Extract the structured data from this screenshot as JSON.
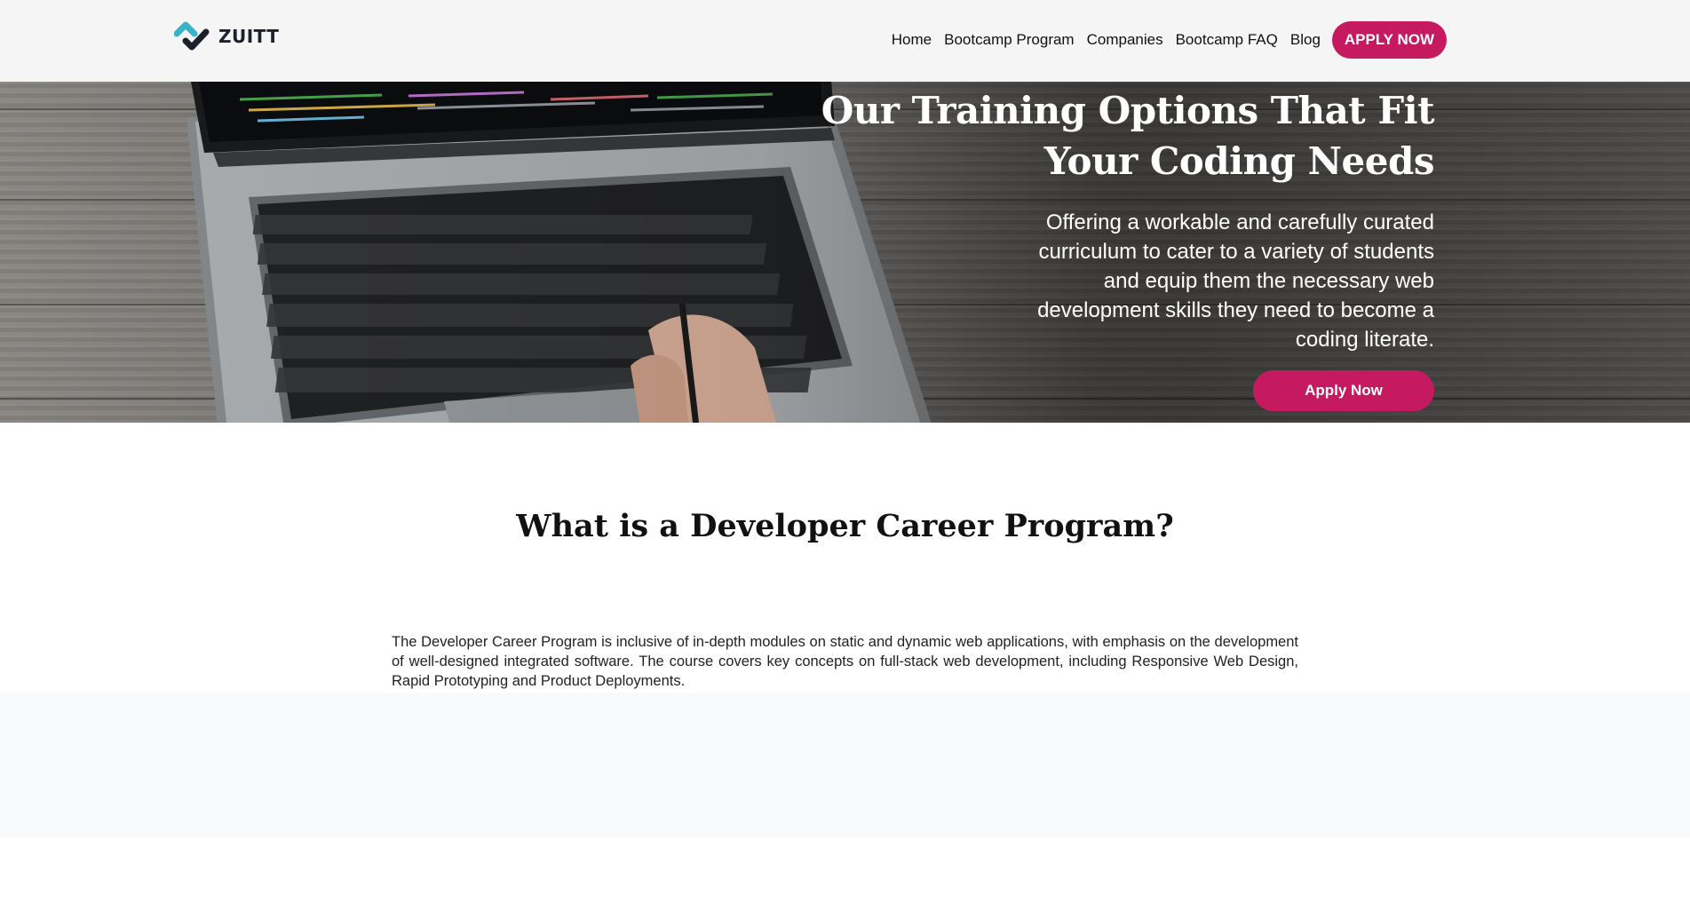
{
  "brand": {
    "name": "ZUITT",
    "logo_icon": "zuitt-check-logo",
    "colors": {
      "teal": "#3ab3c6",
      "dark": "#1d1f2b"
    }
  },
  "nav": {
    "items": [
      {
        "label": "Home"
      },
      {
        "label": "Bootcamp Program"
      },
      {
        "label": "Companies"
      },
      {
        "label": "Bootcamp FAQ"
      },
      {
        "label": "Blog"
      }
    ],
    "apply_label": "APPLY NOW"
  },
  "hero": {
    "title": "Our Training Options That Fit Your Coding Needs",
    "text": "Offering a workable and carefully curated curriculum to cater to a variety of students and equip them the necessary web development skills they need to become a coding literate.",
    "button_label": "Apply Now",
    "background_image": "laptop-on-wooden-desk"
  },
  "section": {
    "title": "What is a Developer Career Program?",
    "text": "The Developer Career Program is inclusive of in-depth modules on static and dynamic web applications, with emphasis on the development of well-designed integrated software. The course covers key concepts on full-stack web development, including Responsive Web Design, Rapid Prototyping and Product Deployments."
  },
  "colors": {
    "accent": "#c51a60",
    "navbar_bg": "#f5f5f5",
    "band_bg": "#f8f9fa"
  }
}
